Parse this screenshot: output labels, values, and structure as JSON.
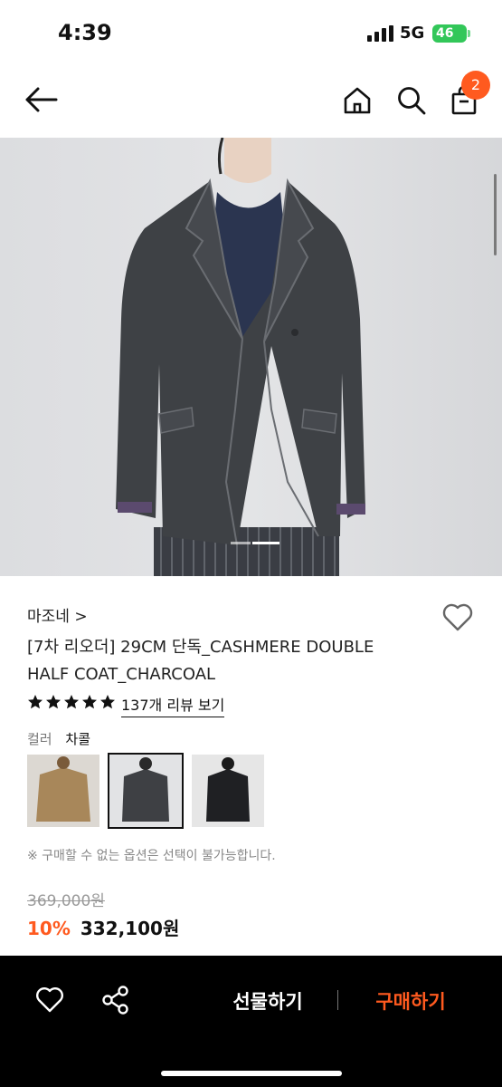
{
  "status_bar": {
    "time": "4:39",
    "network": "5G",
    "battery": "46"
  },
  "header": {
    "cart_count": "2"
  },
  "product": {
    "brand": "마조네 >",
    "title": "[7차 리오더] 29CM 단독_CASHMERE DOUBLE HALF COAT_CHARCOAL",
    "rating_stars": 5,
    "review_link": "137개 리뷰 보기",
    "color_label": "컬러",
    "color_value": "차콜",
    "option_notice": "※ 구매할 수 없는 옵션은 선택이 불가능합니다.",
    "original_price": "369,000원",
    "discount": "10%",
    "sale_price": "332,100원"
  },
  "swatches": [
    {
      "name": "camel",
      "color": "#a8875a",
      "selected": false
    },
    {
      "name": "charcoal",
      "color": "#3e4044",
      "selected": true
    },
    {
      "name": "black",
      "color": "#1f2023",
      "selected": false
    }
  ],
  "bottom_bar": {
    "gift_label": "선물하기",
    "buy_label": "구매하기"
  },
  "colors": {
    "accent": "#ff5a1f",
    "battery": "#32c759",
    "bar_bg": "#000000"
  }
}
